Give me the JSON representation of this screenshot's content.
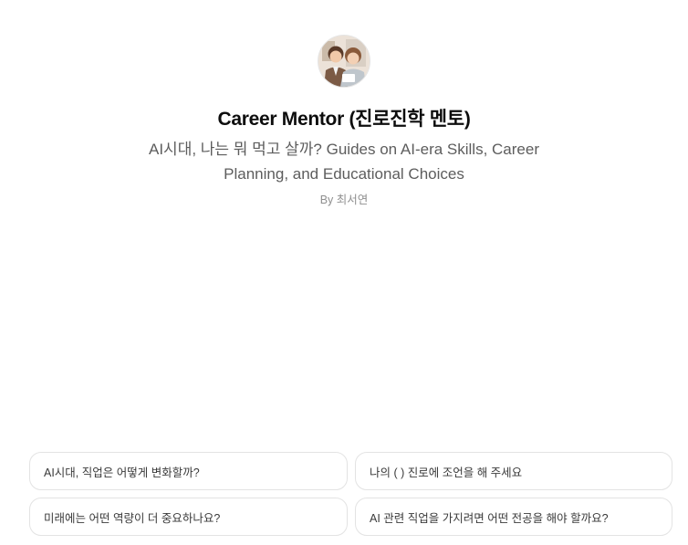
{
  "gpt": {
    "title": "Career Mentor (진로진학 멘토)",
    "subtitle": "AI시대, 나는 뭐 먹고 살까? Guides on AI-era Skills, Career Planning, and Educational Choices",
    "author": "By 최서연"
  },
  "starters": [
    {
      "label": "AI시대, 직업은 어떻게 변화할까?"
    },
    {
      "label": "나의 ( ) 진로에 조언을 해 주세요"
    },
    {
      "label": "미래에는 어떤 역량이 더 중요하나요?"
    },
    {
      "label": "AI 관련 직업을 가지려면 어떤 전공을 해야 할까요?"
    }
  ]
}
